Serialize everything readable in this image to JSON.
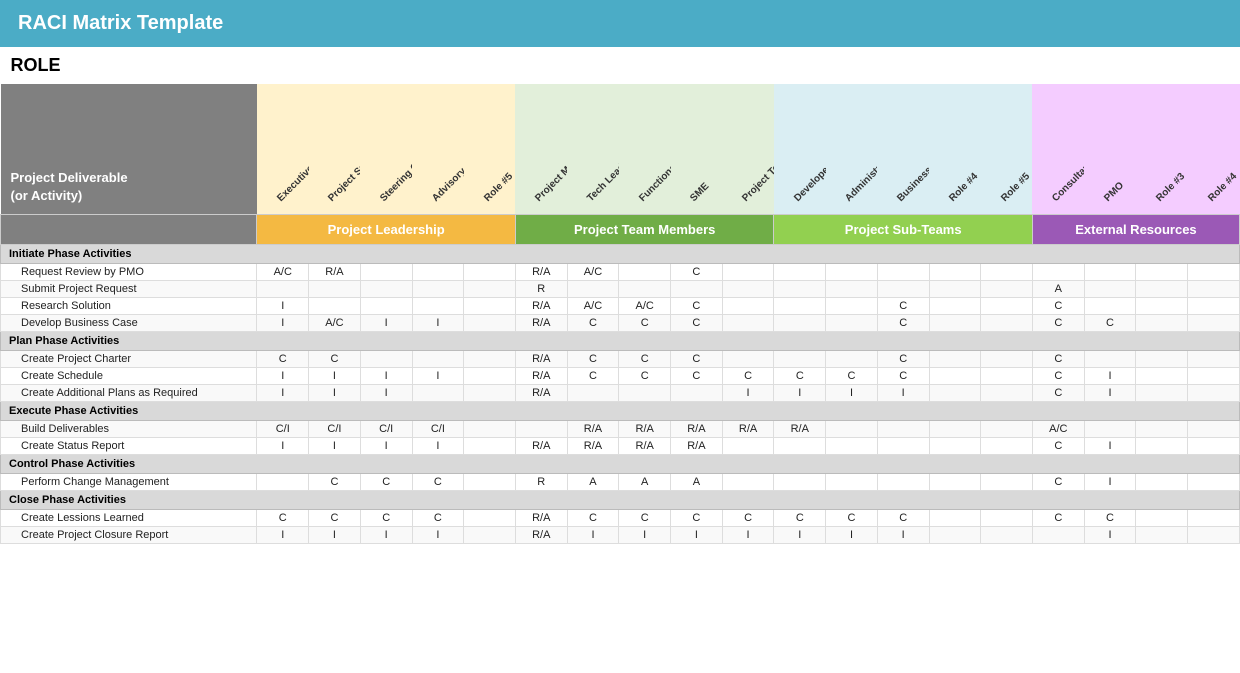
{
  "title": "RACI Matrix Template",
  "role_label": "ROLE",
  "activity_header_line1": "Project Deliverable",
  "activity_header_line2": "(or Activity)",
  "groups": [
    {
      "label": "Project Leadership",
      "class": "grp-leadership",
      "span": 5,
      "diag_class": "diag-leadership"
    },
    {
      "label": "Project Team Members",
      "class": "grp-team",
      "span": 5,
      "diag_class": "diag-team"
    },
    {
      "label": "Project Sub-Teams",
      "class": "grp-subteam",
      "span": 5,
      "diag_class": "diag-subteam"
    },
    {
      "label": "External Resources",
      "class": "grp-external",
      "span": 5,
      "diag_class": "diag-external"
    }
  ],
  "columns": [
    {
      "label": "Executive Sponsor",
      "group": "leadership"
    },
    {
      "label": "Project Sponsor",
      "group": "leadership"
    },
    {
      "label": "Steering Committee",
      "group": "leadership"
    },
    {
      "label": "Advisory Committee",
      "group": "leadership"
    },
    {
      "label": "Role #5",
      "group": "leadership"
    },
    {
      "label": "Project Manager",
      "group": "team"
    },
    {
      "label": "Tech Lead",
      "group": "team"
    },
    {
      "label": "Functional Lead",
      "group": "team"
    },
    {
      "label": "SME",
      "group": "team"
    },
    {
      "label": "Project Team Member",
      "group": "team"
    },
    {
      "label": "Developer",
      "group": "subteam"
    },
    {
      "label": "Administrative Support",
      "group": "subteam"
    },
    {
      "label": "Business Analyst",
      "group": "subteam"
    },
    {
      "label": "Role #4",
      "group": "subteam"
    },
    {
      "label": "Role #5",
      "group": "subteam"
    },
    {
      "label": "Consultant",
      "group": "external"
    },
    {
      "label": "PMO",
      "group": "external"
    },
    {
      "label": "Role #3",
      "group": "external"
    },
    {
      "label": "Role #4",
      "group": "external"
    }
  ],
  "phases": [
    {
      "phase_label": "Initiate Phase Activities",
      "rows": [
        {
          "activity": "Request Review by PMO",
          "values": [
            "A/C",
            "R/A",
            "",
            "",
            "",
            "R/A",
            "A/C",
            "",
            "C",
            "",
            "",
            "",
            "",
            "",
            "",
            "",
            "",
            "",
            ""
          ]
        },
        {
          "activity": "Submit Project Request",
          "values": [
            "",
            "",
            "",
            "",
            "",
            "R",
            "",
            "",
            "",
            "",
            "",
            "",
            "",
            "",
            "",
            "A",
            "",
            "",
            ""
          ]
        },
        {
          "activity": "Research Solution",
          "values": [
            "I",
            "",
            "",
            "",
            "",
            "R/A",
            "A/C",
            "A/C",
            "C",
            "",
            "",
            "",
            "C",
            "",
            "",
            "C",
            "",
            "",
            ""
          ]
        },
        {
          "activity": "Develop Business Case",
          "values": [
            "I",
            "A/C",
            "I",
            "I",
            "",
            "R/A",
            "C",
            "C",
            "C",
            "",
            "",
            "",
            "C",
            "",
            "",
            "C",
            "C",
            "",
            ""
          ]
        }
      ]
    },
    {
      "phase_label": "Plan Phase Activities",
      "rows": [
        {
          "activity": "Create Project Charter",
          "values": [
            "C",
            "C",
            "",
            "",
            "",
            "R/A",
            "C",
            "C",
            "C",
            "",
            "",
            "",
            "C",
            "",
            "",
            "C",
            "",
            "",
            ""
          ]
        },
        {
          "activity": "Create Schedule",
          "values": [
            "I",
            "I",
            "I",
            "I",
            "",
            "R/A",
            "C",
            "C",
            "C",
            "C",
            "C",
            "C",
            "C",
            "",
            "",
            "C",
            "I",
            "",
            ""
          ]
        },
        {
          "activity": "Create Additional Plans as Required",
          "values": [
            "I",
            "I",
            "I",
            "",
            "",
            "R/A",
            "",
            "",
            "",
            "I",
            "I",
            "I",
            "I",
            "",
            "",
            "C",
            "I",
            "",
            ""
          ]
        }
      ]
    },
    {
      "phase_label": "Execute Phase Activities",
      "rows": [
        {
          "activity": "Build Deliverables",
          "values": [
            "C/I",
            "C/I",
            "C/I",
            "C/I",
            "",
            "",
            "R/A",
            "R/A",
            "R/A",
            "R/A",
            "R/A",
            "",
            "",
            "",
            "",
            "A/C",
            "",
            "",
            ""
          ]
        },
        {
          "activity": "Create Status Report",
          "values": [
            "I",
            "I",
            "I",
            "I",
            "",
            "R/A",
            "R/A",
            "R/A",
            "R/A",
            "",
            "",
            "",
            "",
            "",
            "",
            "C",
            "I",
            "",
            ""
          ]
        }
      ]
    },
    {
      "phase_label": "Control Phase Activities",
      "rows": [
        {
          "activity": "Perform Change Management",
          "values": [
            "",
            "C",
            "C",
            "C",
            "",
            "R",
            "A",
            "A",
            "A",
            "",
            "",
            "",
            "",
            "",
            "",
            "C",
            "I",
            "",
            ""
          ]
        }
      ]
    },
    {
      "phase_label": "Close Phase Activities",
      "rows": [
        {
          "activity": "Create Lessions Learned",
          "values": [
            "C",
            "C",
            "C",
            "C",
            "",
            "R/A",
            "C",
            "C",
            "C",
            "C",
            "C",
            "C",
            "C",
            "",
            "",
            "C",
            "C",
            "",
            ""
          ]
        },
        {
          "activity": "Create Project Closure Report",
          "values": [
            "I",
            "I",
            "I",
            "I",
            "",
            "R/A",
            "I",
            "I",
            "I",
            "I",
            "I",
            "I",
            "I",
            "",
            "",
            "",
            "I",
            "",
            ""
          ]
        }
      ]
    }
  ]
}
